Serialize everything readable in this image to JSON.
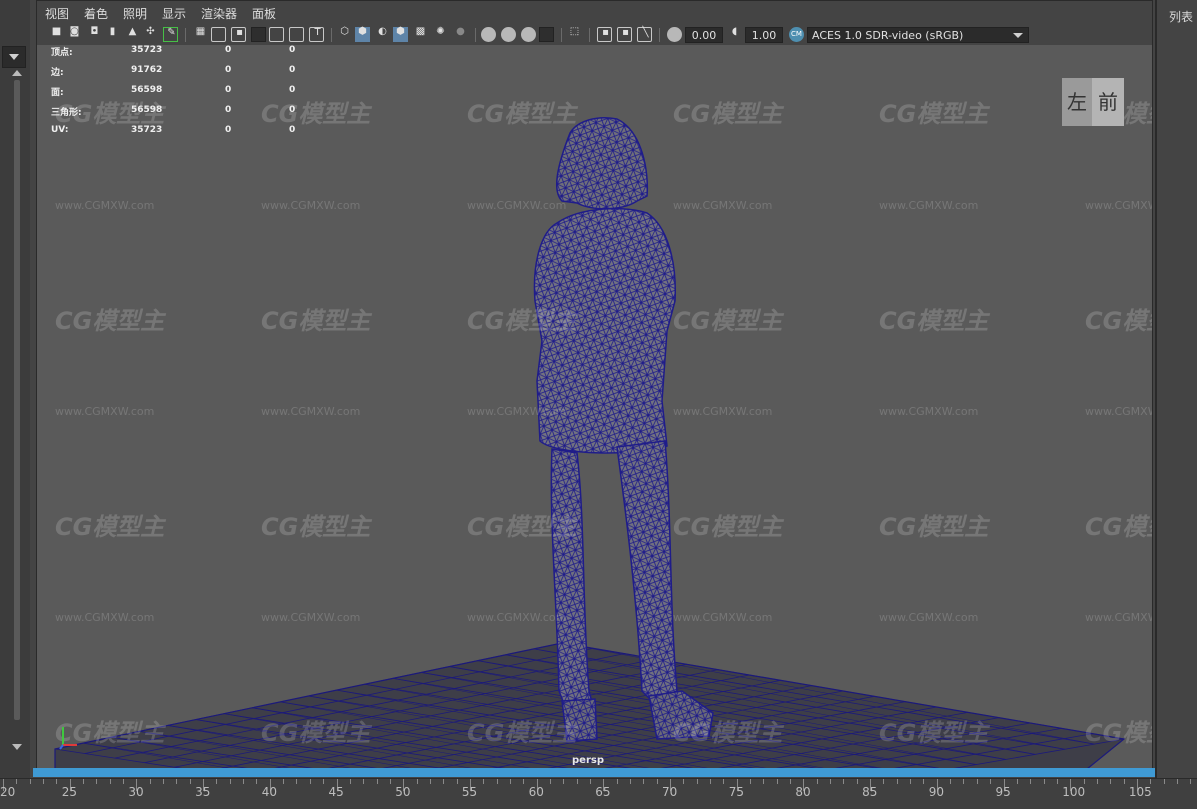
{
  "menu": [
    "视图",
    "着色",
    "照明",
    "显示",
    "渲染器",
    "面板"
  ],
  "toolbar": {
    "exposure_value": "0.00",
    "gamma_value": "1.00",
    "color_space": "ACES 1.0 SDR-video (sRGB)",
    "icons": [
      "camera-icon",
      "camera-attr-icon",
      "bookmark-icon",
      "image-plane-icon",
      "grid-icon",
      "film-gate-icon",
      "wireframe-icon",
      "smooth-shade-icon",
      "textured-icon",
      "lights-icon",
      "shadows-icon",
      "isolate-icon",
      "xray-icon",
      "exposure-icon",
      "gamma-icon",
      "color-mgmt-icon"
    ]
  },
  "hud": {
    "rows": [
      {
        "label": "顶点:",
        "v1": "35723",
        "v2": "0",
        "v3": "0"
      },
      {
        "label": "边:",
        "v1": "91762",
        "v2": "0",
        "v3": "0"
      },
      {
        "label": "面:",
        "v1": "56598",
        "v2": "0",
        "v3": "0"
      },
      {
        "label": "三角形:",
        "v1": "56598",
        "v2": "0",
        "v3": "0"
      },
      {
        "label": "UV:",
        "v1": "35723",
        "v2": "0",
        "v3": "0"
      }
    ]
  },
  "viewcube": {
    "left": "左",
    "front": "前"
  },
  "camera_label": "persp",
  "right_panel_label": "列表",
  "watermark": {
    "logo": "CG模型主",
    "url": "www.CGMXW.com"
  },
  "colors": {
    "wireframe": "#1f1c8a",
    "grid": "#1c1a7a",
    "accent": "#3f9ad4",
    "viewport_bg": "#5a5a5a"
  },
  "ruler": [
    "20",
    "25",
    "30",
    "35",
    "40",
    "45",
    "50",
    "55",
    "60",
    "65",
    "70",
    "75",
    "80",
    "85",
    "90",
    "95",
    "100",
    "105"
  ]
}
